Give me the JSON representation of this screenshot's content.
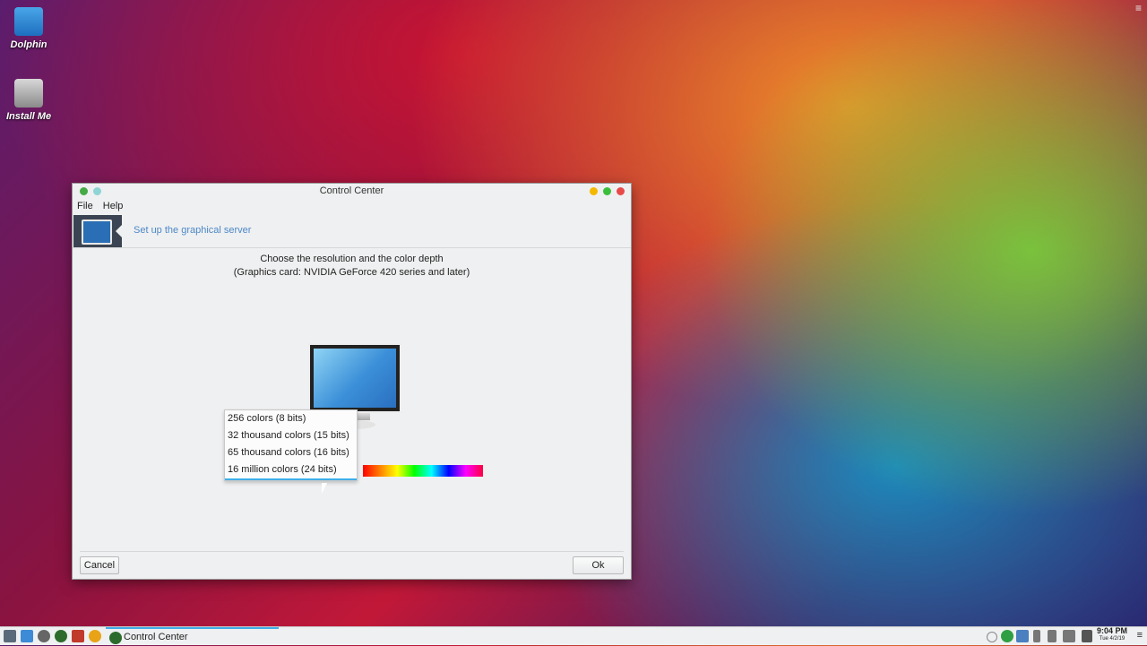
{
  "desktop": {
    "icons": [
      {
        "label": "Dolphin",
        "icon": "dolphin-icon"
      },
      {
        "label": "Install Me",
        "icon": "install-icon"
      }
    ],
    "corner_menu": "≡"
  },
  "window": {
    "title": "Control Center",
    "menu": [
      "File",
      "Help"
    ],
    "header_title": "Set up the graphical server",
    "desc_line1": "Choose the resolution and the color depth",
    "desc_line2": "(Graphics card: NVIDIA GeForce 420 series and later)",
    "color_options": [
      "256 colors (8 bits)",
      "32 thousand colors (15 bits)",
      "65 thousand colors (16 bits)",
      "16 million colors (24 bits)"
    ],
    "selected_option": "16 million colors (24 bits)",
    "cancel_label": "Cancel",
    "ok_label": "Ok"
  },
  "taskbar": {
    "active_task": "Control Center",
    "time": "9:04 PM",
    "date": "Tue 4/2/19",
    "menu": "≡"
  },
  "colors": {
    "accent": "#3daee9",
    "link": "#4c88c8",
    "header_icon_bg": "#3b4452"
  }
}
